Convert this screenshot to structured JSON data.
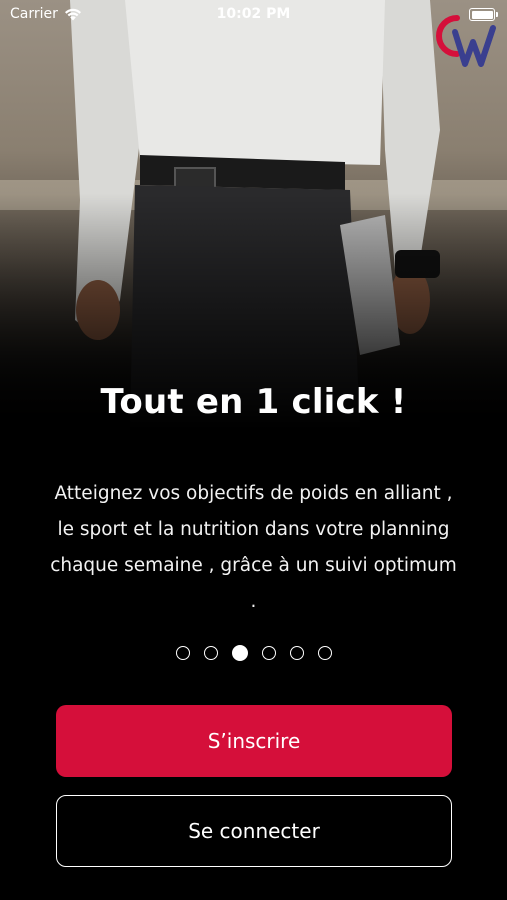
{
  "status_bar": {
    "carrier": "Carrier",
    "time": "10:02 PM"
  },
  "brand": {
    "logo_alt": "CW",
    "logo_colors": [
      "#d50f3a",
      "#3a3f8f"
    ]
  },
  "slide": {
    "title": "Tout en 1 click !",
    "description": "Atteignez vos objectifs de poids en alliant , le sport et la nutrition dans votre planning chaque semaine , grâce à un suivi optimum ."
  },
  "pager": {
    "count": 6,
    "active_index": 2
  },
  "actions": {
    "signup_label": "S’inscrire",
    "login_label": "Se connecter"
  },
  "colors": {
    "accent": "#d50f3a",
    "background": "#000000"
  }
}
